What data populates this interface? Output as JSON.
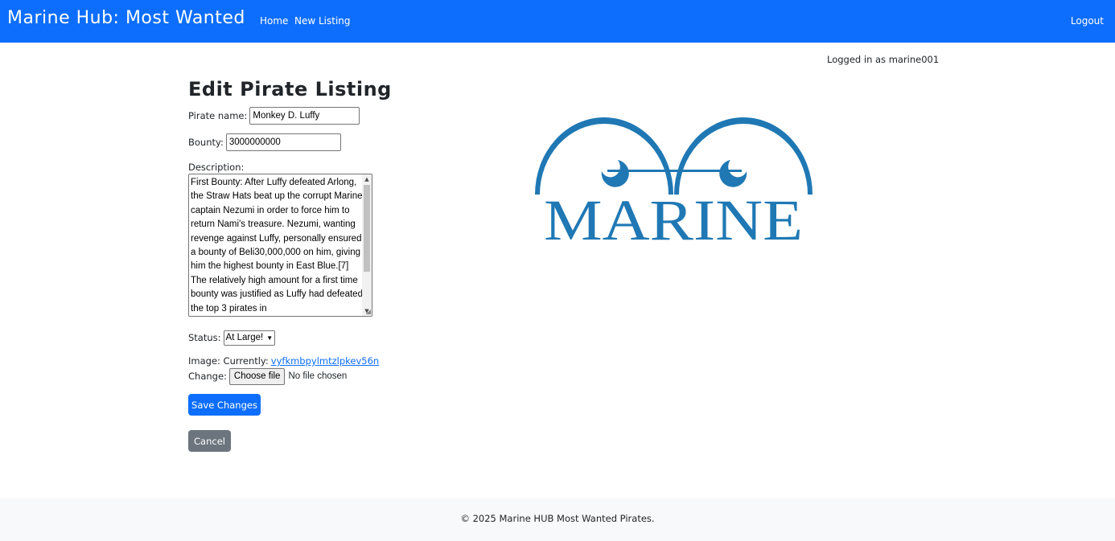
{
  "navbar": {
    "brand": "Marine Hub: Most Wanted",
    "links": [
      "Home",
      "New Listing"
    ],
    "logout": "Logout",
    "color": "#0d6efd"
  },
  "session": {
    "logged_in_text": "Logged in as marine001"
  },
  "form": {
    "title": "Edit Pirate Listing",
    "pirate_name_label": "Pirate name:",
    "pirate_name_value": "Monkey D. Luffy",
    "bounty_label": "Bounty:",
    "bounty_value": "3000000000",
    "description_label": "Description:",
    "description_value": "First Bounty: After Luffy defeated Arlong, the Straw Hats beat up the corrupt Marine captain Nezumi in order to force him to return Nami's treasure. Nezumi, wanting revenge against Luffy, personally ensured a bounty of Beli30,000,000 on him, giving him the highest bounty in East Blue.[7] The relatively high amount for a first time bounty was justified as Luffy had defeated the top 3 pirates in",
    "status_label": "Status:",
    "status_value": "At Large!",
    "image_label": "Image: Currently:",
    "image_current": "vyfkmbpylmtzlpkev56n",
    "change_label": "Change:",
    "choose_file_label": "Choose file",
    "file_status": "No file chosen",
    "save_label": "Save Changes",
    "cancel_label": "Cancel"
  },
  "logo": {
    "text": "MARINE",
    "color": "#1f78b4",
    "icon": "marine-emblem-icon"
  },
  "footer": {
    "text": "© 2025 Marine HUB Most Wanted Pirates."
  },
  "colors": {
    "primary": "#0d6efd",
    "secondary": "#6c757d",
    "footer_bg": "#f8f9fa"
  }
}
